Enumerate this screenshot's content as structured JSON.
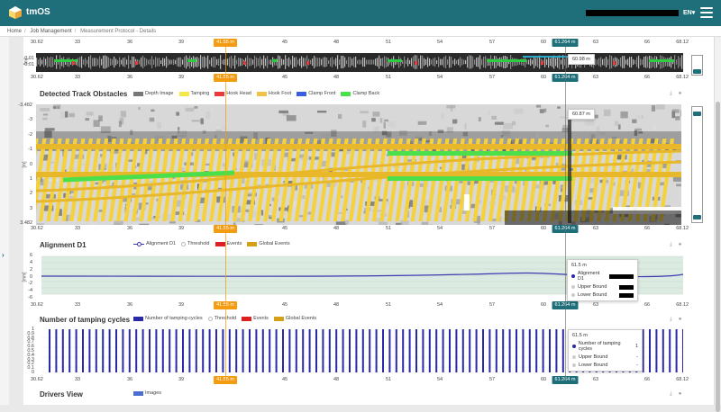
{
  "app": {
    "name": "tmOS",
    "language": "EN"
  },
  "breadcrumb": [
    "Home",
    "Job Management",
    "Measurement Protocol - Details"
  ],
  "axis_ticks": [
    "30.62",
    "33",
    "36",
    "39",
    "42",
    "45",
    "48",
    "51",
    "54",
    "57",
    "60",
    "63",
    "66",
    "68.12"
  ],
  "axis_marker_left": "41.55 m",
  "axis_marker_right": "61.264 m",
  "top_strip": {
    "yunit": "[m]",
    "ylabels": [
      "0.01",
      "-0.01"
    ],
    "hover_label": "60.98 m"
  },
  "obstacles": {
    "title": "Detected Track Obstacles",
    "legend": [
      {
        "label": "Depth Image",
        "color": "#777777"
      },
      {
        "label": "Tamping",
        "color": "#f5e84a"
      },
      {
        "label": "Hook Head",
        "color": "#e83b3b"
      },
      {
        "label": "Hook Foot",
        "color": "#f2c14a"
      },
      {
        "label": "Clamp Front",
        "color": "#3a5ee0"
      },
      {
        "label": "Clamp Back",
        "color": "#4be04b"
      }
    ],
    "yunit": "[m]",
    "ylabels": [
      "-3.482",
      "-3",
      "-2",
      "-1",
      "0",
      "1",
      "2",
      "3",
      "3.482"
    ],
    "hover_label": "60.87 m"
  },
  "alignment": {
    "title": "Alignment D1",
    "legend": [
      "Alignment D1",
      "Threshold",
      "Events",
      "Global Events"
    ],
    "legend_colors": {
      "events": "#e02020",
      "global": "#d4a017"
    },
    "yunit": "[mm]",
    "ylabels": [
      "6",
      "4",
      "2",
      "0",
      "-2",
      "-4",
      "-6"
    ],
    "tooltip": {
      "header": "61.5 m",
      "rows": [
        "Alignment D1",
        "Upper Bound",
        "Lower Bound"
      ]
    }
  },
  "tamping": {
    "title": "Number of tamping cycles",
    "legend": [
      "Number of tamping cycles",
      "Threshold",
      "Events",
      "Global Events"
    ],
    "ylabels": [
      "1",
      "0.9",
      "0.8",
      "0.7",
      "0.6",
      "0.5",
      "0.4",
      "0.3",
      "0.2",
      "0.1",
      "0"
    ],
    "tooltip": {
      "header": "61.5 m",
      "rows": [
        "Number of tamping cycles",
        "Upper Bound",
        "Lower Bound"
      ],
      "values": [
        "1",
        "-",
        "-"
      ]
    }
  },
  "drivers": {
    "title": "Drivers View",
    "legend": [
      "Images"
    ]
  },
  "colors": {
    "brand": "#1e6f7a",
    "orange_marker": "#f39c12",
    "alignment_line": "#3a3ab0",
    "tamping_bar": "#2a2aa8"
  }
}
